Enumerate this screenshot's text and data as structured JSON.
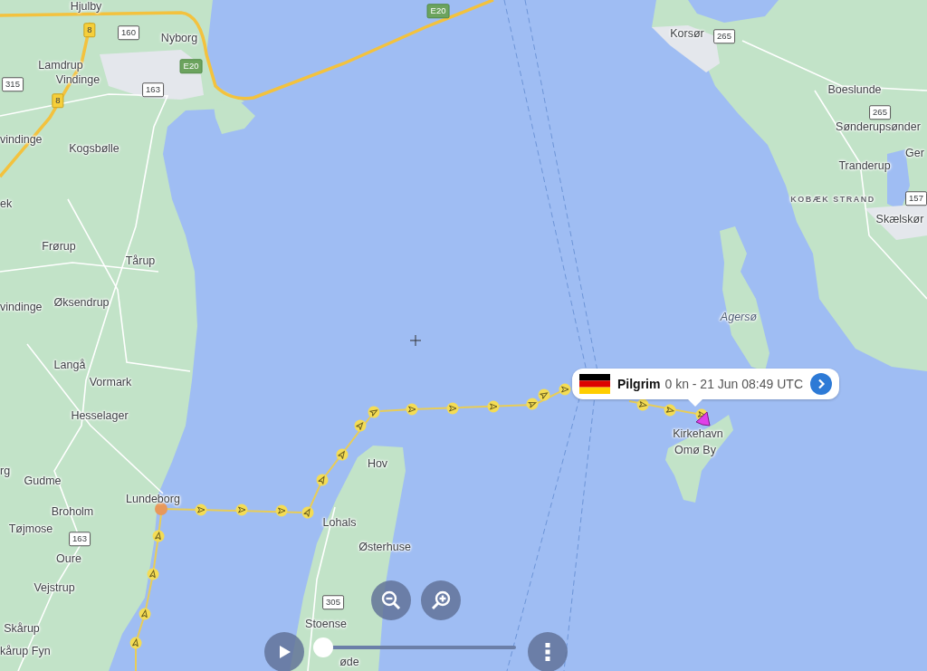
{
  "map": {
    "labels": [
      {
        "text": "Hjulby",
        "kind": "town"
      },
      {
        "text": "Korsør",
        "kind": "town"
      },
      {
        "text": "Nyborg",
        "kind": "town"
      },
      {
        "text": "Lamdrup",
        "kind": "town"
      },
      {
        "text": "Vindinge",
        "kind": "town"
      },
      {
        "text": "Boeslunde",
        "kind": "town"
      },
      {
        "text": "Sønderupsønder",
        "kind": "town"
      },
      {
        "text": "vindinge",
        "kind": "town"
      },
      {
        "text": "Kogsbølle",
        "kind": "town"
      },
      {
        "text": "Ger",
        "kind": "town"
      },
      {
        "text": "Tranderup",
        "kind": "town"
      },
      {
        "text": "KOBÆK STRAND",
        "kind": "district"
      },
      {
        "text": "ek",
        "kind": "town"
      },
      {
        "text": "Skælskør",
        "kind": "town"
      },
      {
        "text": "Frørup",
        "kind": "town"
      },
      {
        "text": "Tårup",
        "kind": "town"
      },
      {
        "text": "Øksendrup",
        "kind": "town"
      },
      {
        "text": "vindinge",
        "kind": "town"
      },
      {
        "text": "Agersø",
        "kind": "island"
      },
      {
        "text": "Langå",
        "kind": "town"
      },
      {
        "text": "Vormark",
        "kind": "town"
      },
      {
        "text": "Hesselager",
        "kind": "town"
      },
      {
        "text": "Kirkehavn",
        "kind": "town"
      },
      {
        "text": "Omø By",
        "kind": "town"
      },
      {
        "text": "Hov",
        "kind": "town"
      },
      {
        "text": "rg",
        "kind": "town"
      },
      {
        "text": "Gudme",
        "kind": "town"
      },
      {
        "text": "Lundeborg",
        "kind": "town"
      },
      {
        "text": "Broholm",
        "kind": "town"
      },
      {
        "text": "Lohals",
        "kind": "town"
      },
      {
        "text": "Tøjmose",
        "kind": "town"
      },
      {
        "text": "Østerhuse",
        "kind": "town"
      },
      {
        "text": "Oure",
        "kind": "town"
      },
      {
        "text": "Vejstrup",
        "kind": "town"
      },
      {
        "text": "Stoense",
        "kind": "town"
      },
      {
        "text": "Skårup",
        "kind": "town"
      },
      {
        "text": "kårup Fyn",
        "kind": "town"
      },
      {
        "text": "øde",
        "kind": "town"
      }
    ],
    "shields": [
      {
        "text": "E20",
        "kind": "motorway"
      },
      {
        "text": "8",
        "kind": "primary"
      },
      {
        "text": "160",
        "kind": "secondary"
      },
      {
        "text": "265",
        "kind": "secondary"
      },
      {
        "text": "E20",
        "kind": "motorway"
      },
      {
        "text": "315",
        "kind": "secondary"
      },
      {
        "text": "163",
        "kind": "secondary"
      },
      {
        "text": "8",
        "kind": "primary"
      },
      {
        "text": "265",
        "kind": "secondary"
      },
      {
        "text": "157",
        "kind": "secondary"
      },
      {
        "text": "163",
        "kind": "secondary"
      },
      {
        "text": "305",
        "kind": "secondary"
      }
    ]
  },
  "vessel_popup": {
    "name": "Pilgrim",
    "details": "0 kn - 21 Jun 08:49 UTC"
  },
  "timeline": {
    "level": 0
  }
}
